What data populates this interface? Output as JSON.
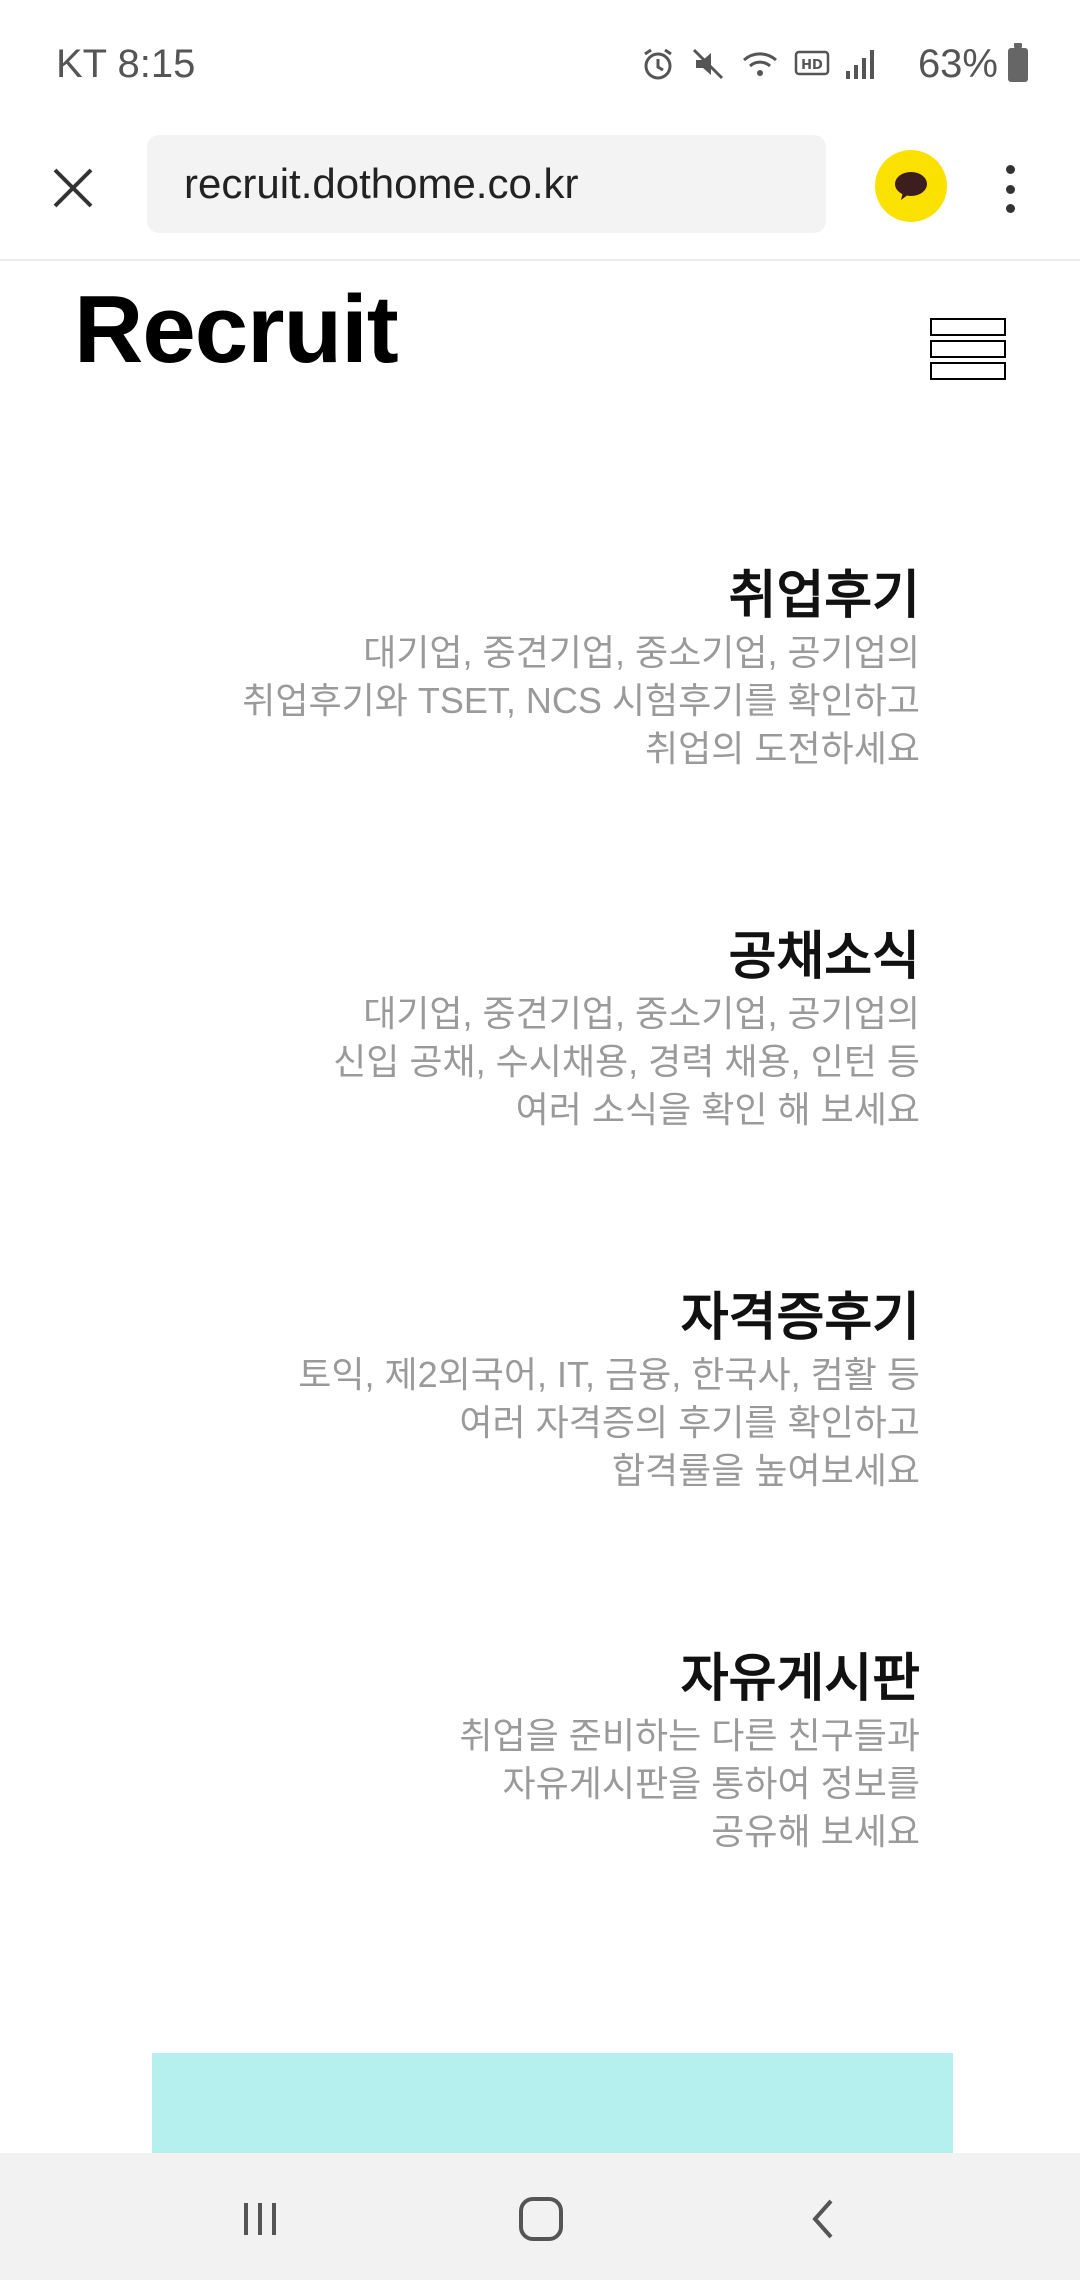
{
  "status_bar": {
    "carrier_time": "KT 8:15",
    "battery": "63%",
    "icons": [
      "alarm-icon",
      "mute-icon",
      "wifi-icon",
      "hd-icon",
      "signal-icon",
      "battery-icon"
    ]
  },
  "browser": {
    "url": "recruit.dothome.co.kr",
    "kakao_color": "#fae100"
  },
  "page": {
    "logo": "Recruit",
    "sections": [
      {
        "title": "취업후기",
        "lines": [
          "대기업, 중견기업, 중소기업, 공기업의",
          "취업후기와 TSET, NCS 시험후기를 확인하고",
          "취업의 도전하세요"
        ]
      },
      {
        "title": "공채소식",
        "lines": [
          "대기업, 중견기업, 중소기업, 공기업의",
          "신입 공채, 수시채용, 경력 채용, 인턴 등",
          "여러 소식을 확인 해 보세요"
        ]
      },
      {
        "title": "자격증후기",
        "lines": [
          "토익, 제2외국어, IT, 금융, 한국사, 컴활 등",
          "여러 자격증의 후기를 확인하고",
          "합격률을 높여보세요"
        ]
      },
      {
        "title": "자유게시판",
        "lines": [
          "취업을 준비하는 다른 친구들과",
          "자유게시판을 통하여 정보를",
          "공유해 보세요"
        ]
      }
    ],
    "accent_color": "#b5efee"
  }
}
